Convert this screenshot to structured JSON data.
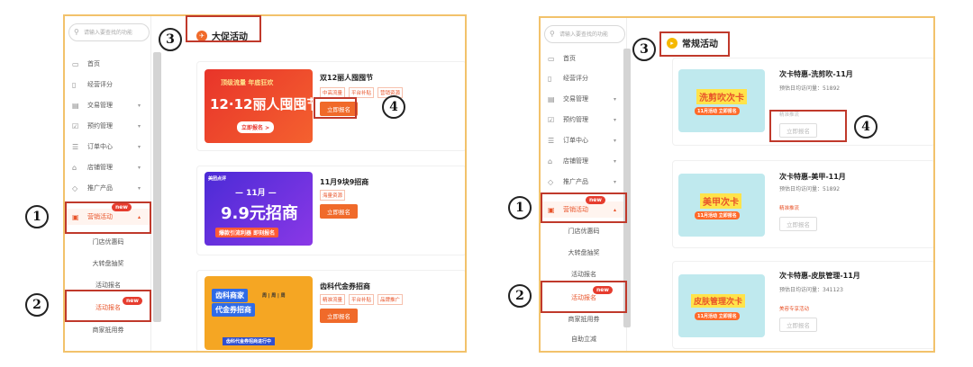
{
  "left": {
    "search_placeholder": "请输入要查找的功能",
    "header_title": "大促活动",
    "menu": [
      "首页",
      "经营评分",
      "交易管理",
      "预约管理",
      "订单中心",
      "店铺管理",
      "推广产品",
      "营销活动"
    ],
    "submenu": [
      "门店优惠码",
      "大转盘抽奖",
      "活动报名",
      "活动报名",
      "商家抵用券"
    ],
    "new_label": "new",
    "cards": [
      {
        "title": "双12丽人囤囤节",
        "tags": [
          "中高流量",
          "平台补贴",
          "营销资源"
        ],
        "button": "立即报名",
        "banner_line1": "顶级流量  年底狂欢",
        "banner_main": "12·12丽人囤囤节",
        "banner_btn": "立即报名 >"
      },
      {
        "title": "11月9块9招商",
        "tags": [
          "海量资源"
        ],
        "button": "立即报名",
        "banner_line1": "— 11月 —",
        "banner_main": "9.9元招商",
        "banner_sub": "爆款引流利器  即刻报名",
        "banner_corner": "美团点评"
      },
      {
        "title": "齿科代金券招商",
        "tags": [
          "精准流量",
          "平台补贴",
          "品牌推广"
        ],
        "button": "立即报名",
        "banner_line1": "齿科商家",
        "banner_main": "代金券招商",
        "banner_sub": "齿科代金券招商进行中",
        "banner_day": "周 | 周 | 周"
      }
    ]
  },
  "right": {
    "search_placeholder": "请输入要查找的功能",
    "header_title": "常规活动",
    "menu": [
      "首页",
      "经营评分",
      "交易管理",
      "预约管理",
      "订单中心",
      "店铺管理",
      "推广产品",
      "营销活动"
    ],
    "submenu": [
      "门店优惠码",
      "大转盘抽奖",
      "活动报名",
      "活动报名",
      "商家抵用券",
      "自助立减"
    ],
    "new_label": "new",
    "cards": [
      {
        "title": "次卡特惠-洗剪吹-11月",
        "meta": "预估日均访问量：51892",
        "tag": "精准推流",
        "button": "立即报名",
        "banner_main": "洗剪吹次卡",
        "banner_sub": "11月活动  立即报名"
      },
      {
        "title": "次卡特惠-美甲-11月",
        "meta": "预估日均访问量：51892",
        "tag": "精准推流",
        "button": "立即报名",
        "banner_main": "美甲次卡",
        "banner_sub": "11月活动  立即报名"
      },
      {
        "title": "次卡特惠-皮肤管理-11月",
        "meta": "预估日均访问量：341123",
        "tag": "美容专享活动",
        "button": "立即报名",
        "banner_main": "皮肤管理次卡",
        "banner_sub": "11月活动  立即报名"
      }
    ]
  },
  "markers": [
    "1",
    "2",
    "3",
    "4"
  ],
  "colors": {
    "accent": "#f06a2a",
    "highlight": "#c0392b",
    "frame": "#f2c26b"
  }
}
